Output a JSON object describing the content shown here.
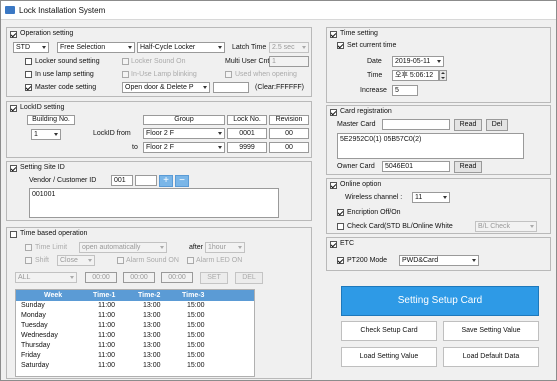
{
  "window": {
    "title": "Lock Installation System"
  },
  "operation": {
    "title": "Operation setting",
    "mode": "STD",
    "selection": "Free Selection",
    "locker_type": "Half-Cycle Locker",
    "latch_label": "Latch Time",
    "latch_value": "2.5 sec",
    "locker_sound": "Locker sound setting",
    "locker_sound_on": "Locker Sound On",
    "multi_user": "Multi User Cnt",
    "multi_user_value": "1",
    "in_use_lamp": "In use lamp setting",
    "in_use_blinking": "In-Use Lamp blinking",
    "used_opening": "Used when opening",
    "master_code": "Master code setting",
    "master_action": "Open door & Delete P",
    "clear_label": "(Clear:FFFFFF)"
  },
  "lockid": {
    "title": "LockID setting",
    "building_header": "Building No.",
    "building_value": "1",
    "lockid_from": "LockID from",
    "to_label": "to",
    "group_header": "Group",
    "lockno_header": "Lock No.",
    "revision_header": "Revision",
    "from_group": "Floor 2 F",
    "from_lock": "0001",
    "from_rev": "00",
    "to_group": "Floor 2 F",
    "to_lock": "9999",
    "to_rev": "00"
  },
  "site": {
    "title": "Setting Site ID",
    "vendor_label": "Vendor / Customer ID",
    "vendor_value": "001",
    "list_item": "001001"
  },
  "time_based": {
    "title": "Time based operation",
    "time_limit": "Time Limit",
    "auto_open": "open automatically",
    "after": "after",
    "after_value": "1hour",
    "shift": "Shift",
    "shift_value": "Close",
    "alarm_sound": "Alarm Sound ON",
    "alarm_led": "Alarm LED ON",
    "day_value": "ALL",
    "time1": "00:00",
    "time2": "00:00",
    "time3": "00:00",
    "set": "SET",
    "del": "DEL",
    "headers": [
      "Week",
      "Time-1",
      "Time-2",
      "Time-3"
    ],
    "rows": [
      [
        "Sunday",
        "11:00",
        "13:00",
        "15:00"
      ],
      [
        "Monday",
        "11:00",
        "13:00",
        "15:00"
      ],
      [
        "Tuesday",
        "11:00",
        "13:00",
        "15:00"
      ],
      [
        "Wednesday",
        "11:00",
        "13:00",
        "15:00"
      ],
      [
        "Thursday",
        "11:00",
        "13:00",
        "15:00"
      ],
      [
        "Friday",
        "11:00",
        "13:00",
        "15:00"
      ],
      [
        "Saturday",
        "11:00",
        "13:00",
        "15:00"
      ]
    ]
  },
  "time_setting": {
    "title": "Time setting",
    "set_current": "Set current time",
    "date_label": "Date",
    "date_value": "2019-05-11",
    "time_label": "Time",
    "time_value": "오후 5:06:12",
    "increase_label": "Increase",
    "increase_value": "5"
  },
  "card": {
    "title": "Card registration",
    "master_label": "Master Card",
    "read": "Read",
    "del": "Del",
    "card_list": "5E2952C0(1)      05B57C0(2)",
    "owner_label": "Owner Card",
    "owner_value": "5046E01",
    "owner_read": "Read"
  },
  "online": {
    "title": "Online option",
    "wireless_label": "Wireless channel :",
    "wireless_value": "11",
    "encryption": "Encription Off/On",
    "check_card": "Check Card(STD BL/Online White",
    "check_value": "B/L Check"
  },
  "etc": {
    "title": "ETC",
    "pt200": "PT200 Mode",
    "pt200_value": "PWD&Card"
  },
  "actions": {
    "setup_card": "Setting Setup Card",
    "check_setup": "Check Setup Card",
    "save_setting": "Save Setting Value",
    "load_setting": "Load Setting Value",
    "load_default": "Load Default Data"
  },
  "colors": {
    "accent": "#2e9ae6",
    "table_header": "#5b9bd5"
  }
}
